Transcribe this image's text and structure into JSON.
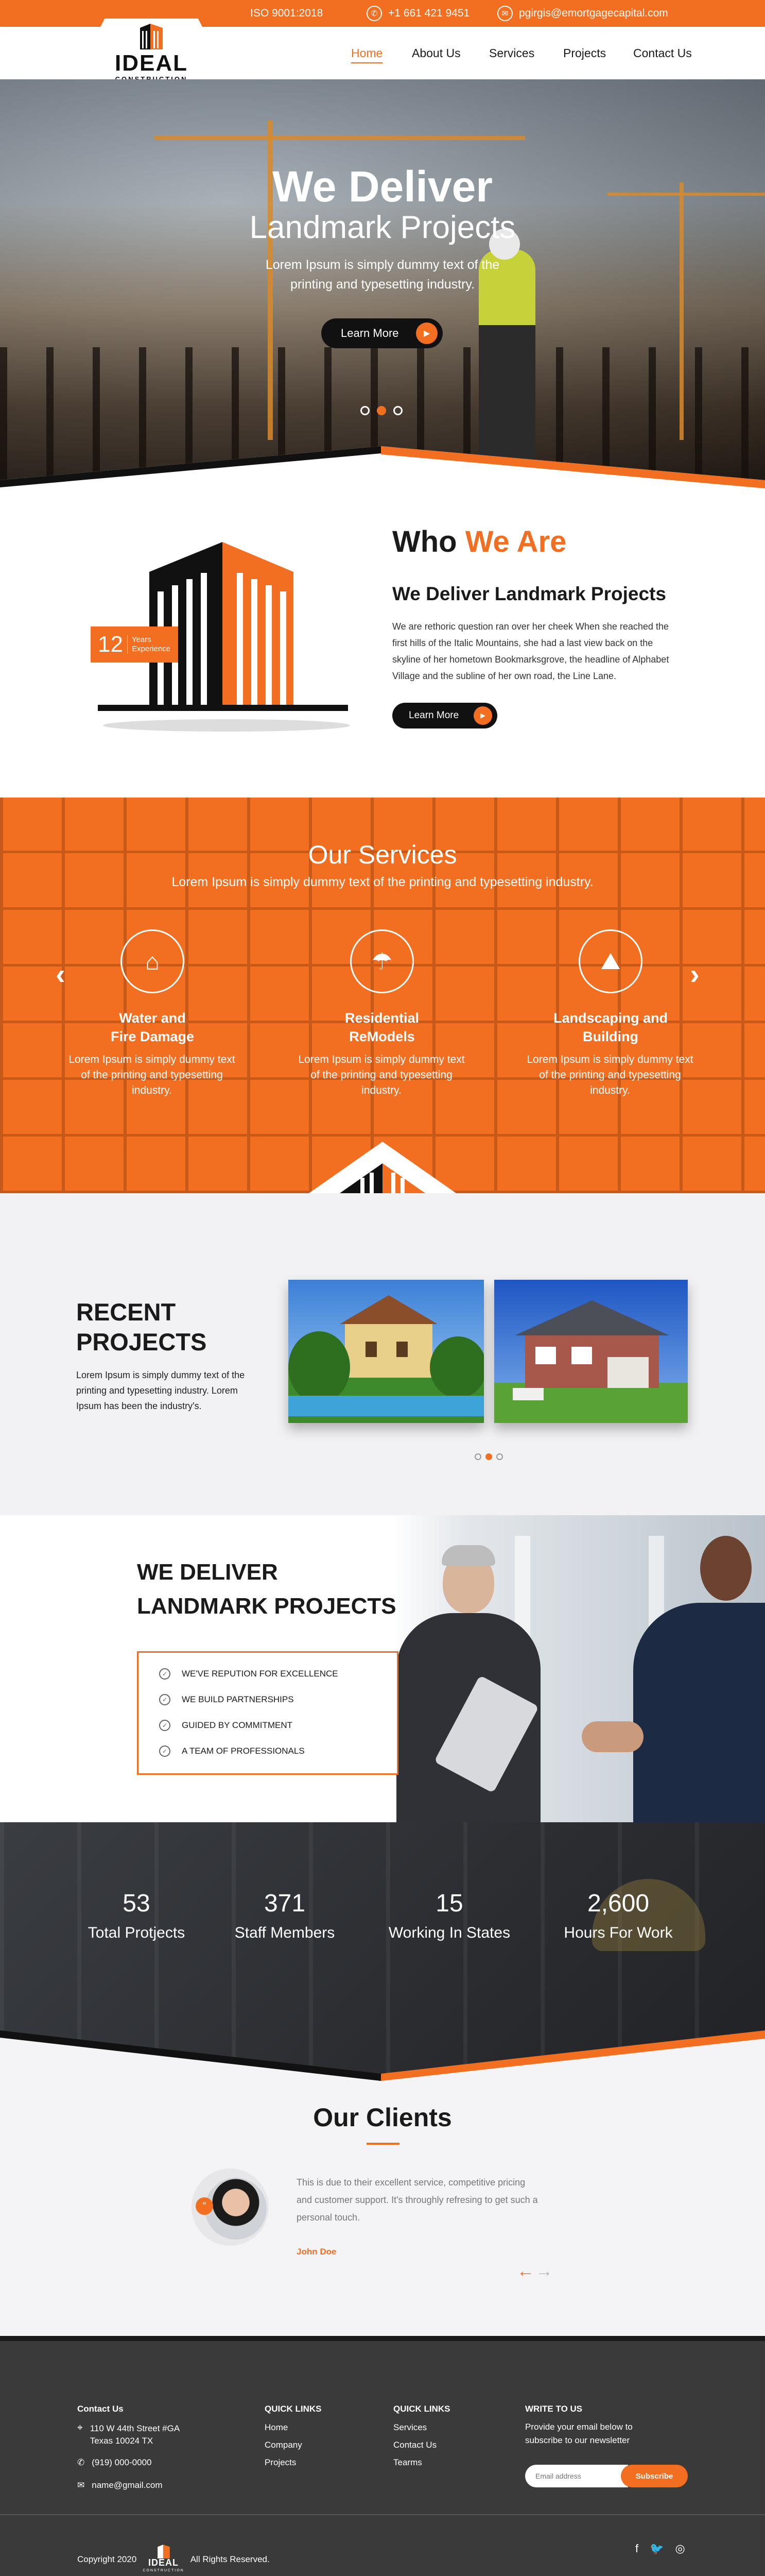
{
  "topbar": {
    "iso": "ISO 9001:2018",
    "phone": "+1 661 421 9451",
    "email": "pgirgis@emortgagecapital.com",
    "phone_icon": "phone-icon",
    "email_icon": "mail-icon"
  },
  "brand": {
    "logo_main": "IDEAL",
    "logo_sub": "CONSTRUCTION",
    "accent": "#f26f21",
    "dark": "#111111"
  },
  "nav": {
    "items": [
      {
        "label": "Home",
        "active": true
      },
      {
        "label": "About Us",
        "active": false
      },
      {
        "label": "Services",
        "active": false
      },
      {
        "label": "Projects",
        "active": false
      },
      {
        "label": "Contact Us",
        "active": false
      }
    ]
  },
  "hero": {
    "title_line1": "We Deliver",
    "title_line2": "Landmark Projects",
    "subtitle_line1": "Lorem Ipsum is simply dummy text of the",
    "subtitle_line2": "printing and typesetting industry.",
    "button": "Learn More",
    "slide_count": 3,
    "active_slide": 2
  },
  "about": {
    "heading_a": "Who",
    "heading_b": "We Are",
    "years": "12",
    "years_label_1": "Years",
    "years_label_2": "Experience",
    "subheading": "We Deliver Landmark Projects",
    "body": "We are rethoric question ran over her cheek When she reached the first hills of the Italic Mountains, she had a last view back on the skyline of her hometown Bookmarksgrove, the headline of Alphabet Village and the subline of her own road, the Line Lane.",
    "button": "Learn More"
  },
  "services": {
    "title": "Our Services",
    "subtitle": "Lorem Ipsum is simply dummy text of the printing and typesetting industry.",
    "items": [
      {
        "icon": "house-fire-icon",
        "title": "Water and\nFire Damage",
        "desc": "Lorem Ipsum is simply dummy text of the printing and typesetting industry."
      },
      {
        "icon": "umbrella-house-icon",
        "title": "Residential\nReModels",
        "desc": "Lorem Ipsum is simply dummy text of the printing and typesetting industry."
      },
      {
        "icon": "landscape-icon",
        "title": "Landscaping and\nBuilding",
        "desc": "Lorem Ipsum is simply dummy text of the printing and typesetting industry."
      }
    ]
  },
  "projects": {
    "title_1": "RECENT",
    "title_2": "PROJECTS",
    "body": "Lorem Ipsum is simply dummy text of the printing and typesetting industry. Lorem Ipsum has been the industry's.",
    "active_dot": 2,
    "dot_count": 3
  },
  "landmark": {
    "title_1": "WE DELIVER",
    "title_2": "LANDMARK PROJECTS",
    "points": [
      "WE'VE REPUTION FOR EXCELLENCE",
      "WE BUILD PARTNERSHIPS",
      "GUIDED BY COMMITMENT",
      "A TEAM OF PROFESSIONALS"
    ]
  },
  "stats": [
    {
      "value": "53",
      "label": "Total Protjects"
    },
    {
      "value": "371",
      "label": "Staff Members"
    },
    {
      "value": "15",
      "label": "Working In States"
    },
    {
      "value": "2,600",
      "label": "Hours For Work"
    }
  ],
  "clients": {
    "title": "Our Clients",
    "quote": "This is due to their excellent service, competitive pricing and customer support. It's throughly refresing to get such a personal touch.",
    "name": "John Doe"
  },
  "footer": {
    "contact_heading": "Contact Us",
    "address_1": "110 W 44th Street #GA",
    "address_2": "Texas 10024 TX",
    "phone": "(919) 000-0000",
    "email": "name@gmail.com",
    "links1_heading": "QUICK LINKS",
    "links1": [
      "Home",
      "Company",
      "Projects"
    ],
    "links2_heading": "QUICK LINKS",
    "links2": [
      "Services",
      "Contact Us",
      "Tearms"
    ],
    "newsletter_heading": "WRITE TO US",
    "newsletter_text": "Provide your email below to subscribe to our newsletter",
    "email_placeholder": "Email address",
    "subscribe": "Subscribe",
    "copyright_a": "Copyright 2020",
    "copyright_b": "All Rights Reserved.",
    "social": [
      "facebook-icon",
      "twitter-icon",
      "instagram-icon"
    ]
  }
}
